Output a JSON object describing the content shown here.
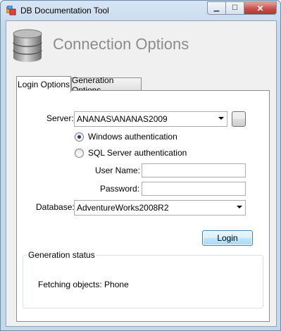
{
  "window": {
    "title": "DB Documentation Tool",
    "controls": {
      "minimize": "▁",
      "maximize": "☐",
      "close": "✕"
    }
  },
  "header": {
    "title": "Connection Options"
  },
  "tabs": [
    {
      "label": "Login Options",
      "active": true
    },
    {
      "label": "Generation Options",
      "active": false
    }
  ],
  "login": {
    "server_label": "Server:",
    "server_value": "ANANAS\\ANANAS2009",
    "browse_button_label": "",
    "windows_auth_label": "Windows authentication",
    "sql_auth_label": "SQL Server authentication",
    "auth_selected": "windows",
    "username_label": "User Name:",
    "username_value": "",
    "password_label": "Password:",
    "password_value": "",
    "database_label": "Database:",
    "database_value": "AdventureWorks2008R2",
    "login_button": "Login"
  },
  "status": {
    "group_title": "Generation status",
    "message": "Fetching objects: Phone"
  },
  "colors": {
    "heading": "#8c8c8c",
    "titlebar": "#c4d8ec",
    "close_button": "#c75050"
  }
}
